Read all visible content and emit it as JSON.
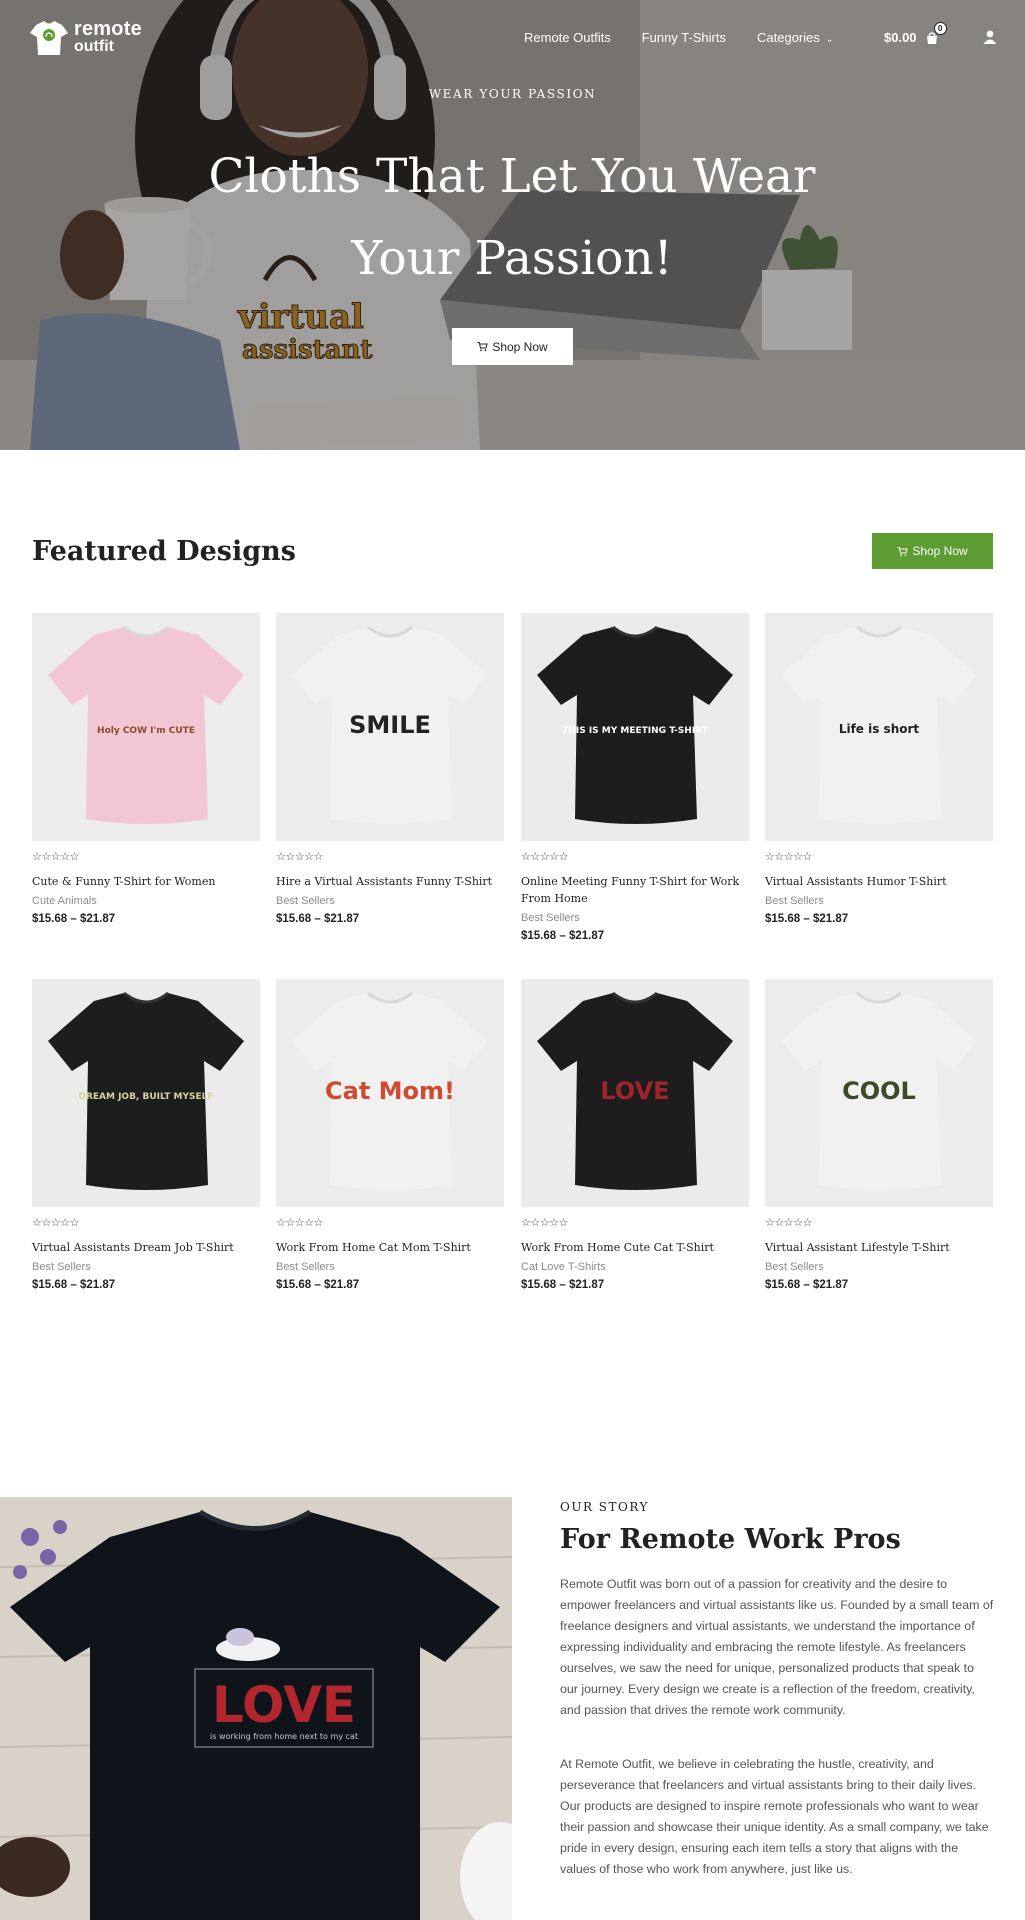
{
  "header": {
    "logo_line1": "remote",
    "logo_line2": "outfit",
    "nav": [
      "Remote Outfits",
      "Funny T-Shirts",
      "Categories"
    ],
    "cart_total": "$0.00",
    "cart_count": "0",
    "icons": [
      "shirt-logo-icon",
      "chevron-down-icon",
      "shopping-bag-icon",
      "user-icon"
    ]
  },
  "hero": {
    "kicker": "WEAR YOUR PASSION",
    "title": "Cloths That Let You Wear Your Passion!",
    "button": "Shop Now",
    "mug_print_line1": "virtual",
    "mug_print_line2": "assistant"
  },
  "featured": {
    "title": "Featured Designs",
    "button": "Shop Now",
    "products": [
      {
        "name": "Cute & Funny T-Shirt for Women",
        "category": "Cute Animals",
        "price": "$15.68 – $21.87",
        "shirt": "#f2c7d3",
        "print": "Holy COW I'm CUTE",
        "ink": "#8a4a2e"
      },
      {
        "name": "Hire a Virtual Assistants Funny T-Shirt",
        "category": "Best Sellers",
        "price": "$15.68 – $21.87",
        "shirt": "#f1f1f1",
        "print": "SMILE",
        "ink": "#222222"
      },
      {
        "name": "Online Meeting Funny T-Shirt for Work From Home",
        "category": "Best Sellers",
        "price": "$15.68 – $21.87",
        "shirt": "#1d1d1d",
        "print": "THIS IS MY MEETING T-SHIRT",
        "ink": "#ffffff"
      },
      {
        "name": "Virtual Assistants Humor T-Shirt",
        "category": "Best Sellers",
        "price": "$15.68 – $21.87",
        "shirt": "#f1f1f1",
        "print": "Life is short",
        "ink": "#222222"
      },
      {
        "name": "Virtual Assistants Dream Job T-Shirt",
        "category": "Best Sellers",
        "price": "$15.68 – $21.87",
        "shirt": "#1d1d1d",
        "print": "DREAM JOB, BUILT MYSELF",
        "ink": "#d9d2a0"
      },
      {
        "name": "Work From Home Cat Mom T-Shirt",
        "category": "Best Sellers",
        "price": "$15.68 – $21.87",
        "shirt": "#f1f1f1",
        "print": "Cat Mom!",
        "ink": "#d04a2f"
      },
      {
        "name": "Work From Home Cute Cat T-Shirt",
        "category": "Cat Love T-Shirts",
        "price": "$15.68 – $21.87",
        "shirt": "#1d1d1d",
        "print": "LOVE",
        "ink": "#a0242a"
      },
      {
        "name": "Virtual Assistant Lifestyle T-Shirt",
        "category": "Best Sellers",
        "price": "$15.68 – $21.87",
        "shirt": "#f1f1f1",
        "print": "COOL",
        "ink": "#3c4a2a"
      }
    ]
  },
  "story": {
    "kicker": "OUR STORY",
    "title": "For Remote Work Pros",
    "paragraph1": "Remote Outfit was born out of a passion for creativity and the desire to empower freelancers and virtual assistants like us. Founded by a small team of freelance designers and virtual assistants, we understand the importance of expressing individuality and embracing the remote lifestyle. As freelancers ourselves, we saw the need for unique, personalized products that speak to our journey. Every design we create is a reflection of the freedom, creativity, and passion that drives the remote work community.",
    "paragraph2": "At Remote Outfit, we believe in celebrating the hustle, creativity, and perseverance that freelancers and virtual assistants bring to their daily lives. Our products are designed to inspire remote professionals who want to wear their passion and showcase their unique identity. As a small company, we take pride in every design, ensuring each item tells a story that aligns with the values of those who work from anywhere, just like us.",
    "shirt_print": "LOVE",
    "shirt_caption": "is working from home next to my cat"
  },
  "colors": {
    "accent": "#5d9c32",
    "text": "#222222",
    "muted": "#8c8c8c"
  }
}
